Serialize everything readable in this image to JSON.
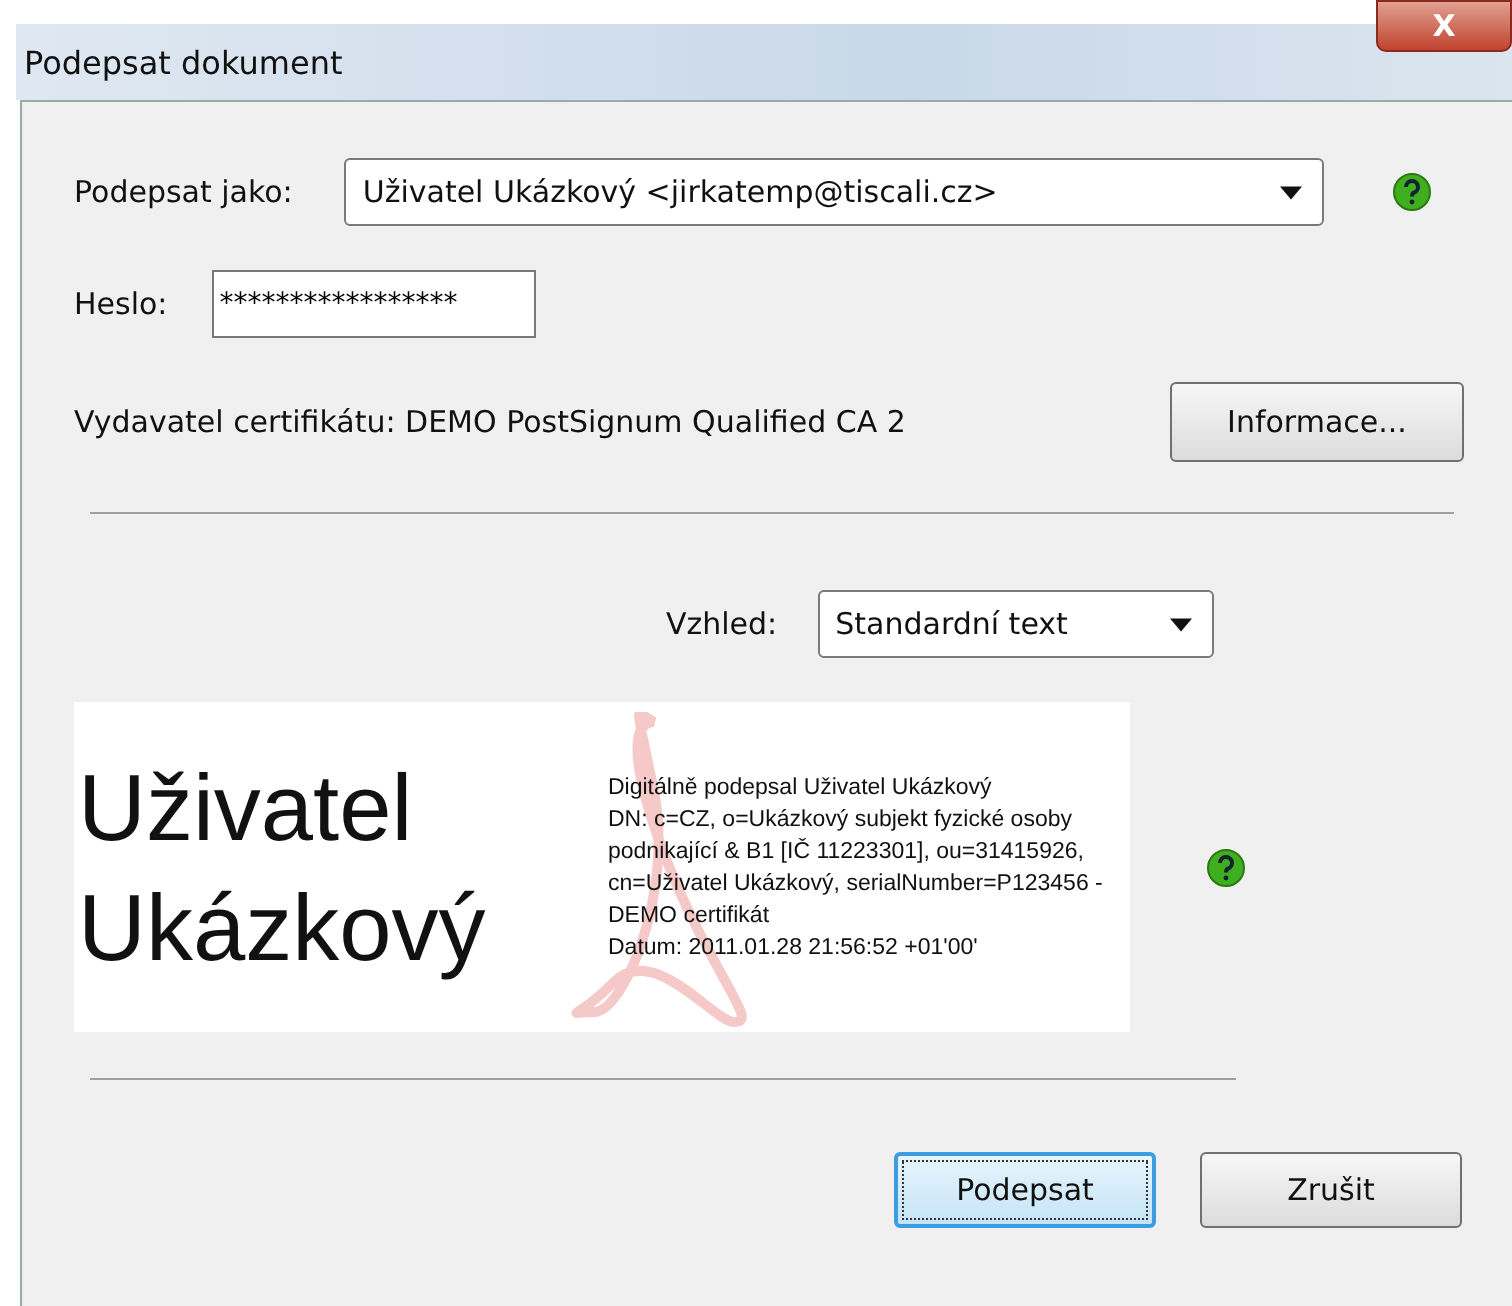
{
  "window": {
    "title": "Podepsat dokument",
    "close_label": "X"
  },
  "sign_as": {
    "label": "Podepsat jako:",
    "value": "Uživatel Ukázkový <jirkatemp@tiscali.cz>"
  },
  "password": {
    "label": "Heslo:",
    "value": "*****************"
  },
  "issuer": {
    "text": "Vydavatel certifikátu: DEMO PostSignum Qualified CA 2",
    "button": "Informace..."
  },
  "appearance": {
    "label": "Vzhled:",
    "value": "Standardní text"
  },
  "preview": {
    "name_lines": [
      "Uživatel",
      "Ukázkový"
    ],
    "details": [
      "Digitálně podepsal Uživatel Ukázkový",
      "DN: c=CZ, o=Ukázkový subjekt fyzické osoby podnikající & B1 [IČ 11223301], ou=31415926, cn=Uživatel Ukázkový, serialNumber=P123456 - DEMO certifikát",
      "Datum: 2011.01.28 21:56:52 +01'00'"
    ]
  },
  "buttons": [
    {
      "label": "Podepsat",
      "selected": true
    },
    {
      "label": "Zrušit",
      "selected": false
    }
  ]
}
